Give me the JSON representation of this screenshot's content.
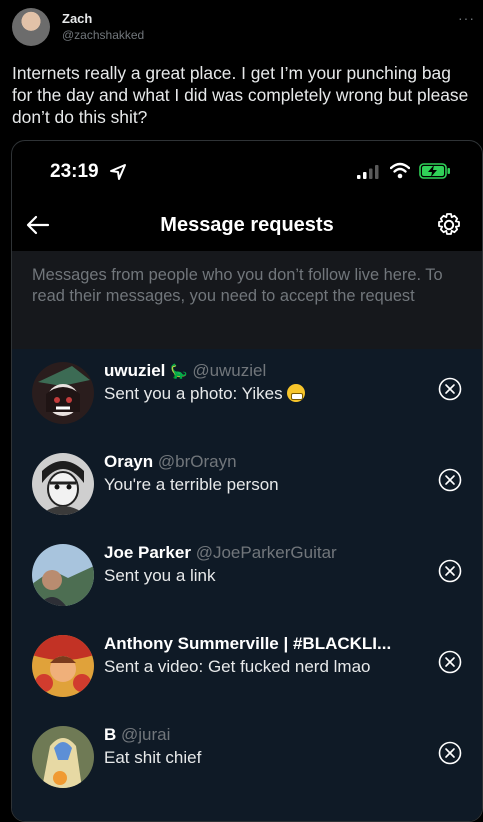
{
  "tweet": {
    "author_name": "Zach",
    "author_handle": "@zachshakked",
    "more_icon": "more-dots-icon",
    "text": "Internets really a great place. I get I’m your punching bag for the day and what I did was completely wrong but please don’t do this shit?"
  },
  "phone": {
    "status": {
      "time": "23:19"
    },
    "nav": {
      "title": "Message requests"
    },
    "notice": "Messages from people who you don’t follow live here. To read their messages, you need to accept the request",
    "requests": [
      {
        "name": "uwuziel",
        "emoji": "🦕",
        "handle": "@uwuziel",
        "message": "Sent you a photo: Yikes",
        "avatar_color": "#3b2a2a"
      },
      {
        "name": "Orayn",
        "emoji": "",
        "handle": "@brOrayn",
        "message": "You're a terrible person",
        "avatar_color": "#9a9a9a"
      },
      {
        "name": "Joe Parker",
        "emoji": "",
        "handle": "@JoeParkerGuitar",
        "message": "Sent you a link",
        "avatar_color": "#6d8fb3"
      },
      {
        "name": "Anthony Summerville | #BLACKLI...",
        "emoji": "",
        "handle": "",
        "message": "Sent a video: Get fucked nerd lmao",
        "avatar_color": "#c33a2b"
      },
      {
        "name": "B",
        "emoji": "",
        "handle": "@jurai",
        "message": "Eat shit chief",
        "avatar_color": "#8a8f6a"
      }
    ]
  },
  "colors": {
    "background": "#000000",
    "panel": "#16181c",
    "list_bg": "#0f1a26",
    "muted": "#71767b",
    "battery": "#30d158"
  }
}
